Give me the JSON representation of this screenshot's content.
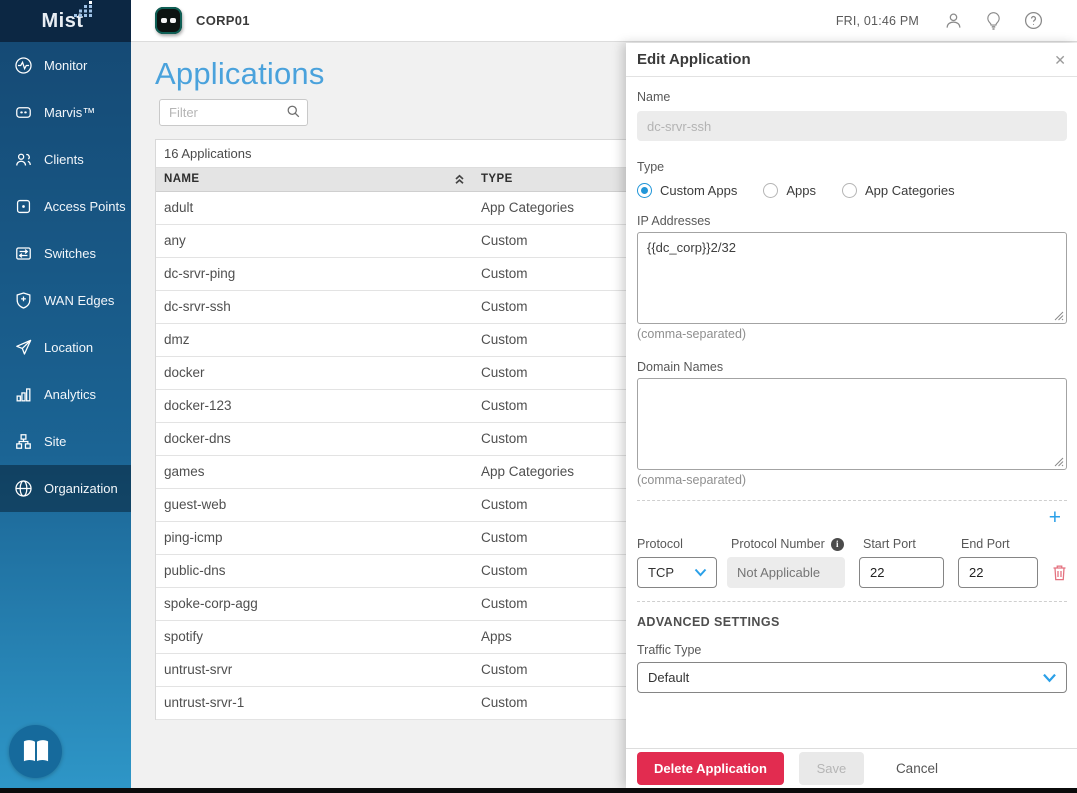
{
  "brand": {
    "logo_text": "Mist"
  },
  "topbar": {
    "org_name": "CORP01",
    "time": "FRI, 01:46 PM",
    "icons": [
      "marvis-icon",
      "account-icon",
      "bulb-icon",
      "help-icon"
    ]
  },
  "sidebar": {
    "active": "Organization",
    "items": [
      {
        "label": "Monitor",
        "icon": "monitor-icon"
      },
      {
        "label": "Marvis™",
        "icon": "marvis-icon"
      },
      {
        "label": "Clients",
        "icon": "clients-icon"
      },
      {
        "label": "Access Points",
        "icon": "access-points-icon"
      },
      {
        "label": "Switches",
        "icon": "switches-icon"
      },
      {
        "label": "WAN Edges",
        "icon": "wan-edges-icon"
      },
      {
        "label": "Location",
        "icon": "location-icon"
      },
      {
        "label": "Analytics",
        "icon": "analytics-icon"
      },
      {
        "label": "Site",
        "icon": "site-icon"
      },
      {
        "label": "Organization",
        "icon": "organization-icon"
      }
    ],
    "help_icon": "open-book-icon"
  },
  "main": {
    "title": "Applications",
    "filter_placeholder": "Filter",
    "count_label": "16 Applications",
    "table": {
      "columns": [
        "NAME",
        "TYPE"
      ],
      "sort_column": "NAME",
      "sort_direction": "asc",
      "rows": [
        [
          "adult",
          "App Categories"
        ],
        [
          "any",
          "Custom"
        ],
        [
          "dc-srvr-ping",
          "Custom"
        ],
        [
          "dc-srvr-ssh",
          "Custom"
        ],
        [
          "dmz",
          "Custom"
        ],
        [
          "docker",
          "Custom"
        ],
        [
          "docker-123",
          "Custom"
        ],
        [
          "docker-dns",
          "Custom"
        ],
        [
          "games",
          "App Categories"
        ],
        [
          "guest-web",
          "Custom"
        ],
        [
          "ping-icmp",
          "Custom"
        ],
        [
          "public-dns",
          "Custom"
        ],
        [
          "spoke-corp-agg",
          "Custom"
        ],
        [
          "spotify",
          "Apps"
        ],
        [
          "untrust-srvr",
          "Custom"
        ],
        [
          "untrust-srvr-1",
          "Custom"
        ]
      ]
    }
  },
  "panel": {
    "title": "Edit Application",
    "close_glyph": "✕",
    "name_label": "Name",
    "name_value": "dc-srvr-ssh",
    "type_label": "Type",
    "type_options": [
      "Custom Apps",
      "Apps",
      "App Categories"
    ],
    "type_selected": "Custom Apps",
    "ip_label": "IP Addresses",
    "ip_value": "{{dc_corp}}2/32",
    "ip_hint": "(comma-separated)",
    "domain_label": "Domain Names",
    "domain_value": "",
    "domain_hint": "(comma-separated)",
    "add_glyph": "+",
    "protocol_label": "Protocol",
    "protocol_value": "TCP",
    "protocol_number_label": "Protocol Number",
    "protocol_number_placeholder": "Not Applicable",
    "start_port_label": "Start Port",
    "start_port_value": "22",
    "end_port_label": "End Port",
    "end_port_value": "22",
    "advanced_label": "ADVANCED SETTINGS",
    "traffic_label": "Traffic Type",
    "traffic_value": "Default",
    "delete_label": "Delete Application",
    "save_label": "Save",
    "cancel_label": "Cancel"
  },
  "colors": {
    "accent_blue": "#2ba0e8",
    "title_blue": "#4aa2dc",
    "sidebar_top": "#154a75",
    "sidebar_bottom": "#2e96c7",
    "logo_bg": "#0c2743",
    "delete_red": "#e22c50",
    "trash_red": "#e4717f",
    "radio_selected": "#2196d8"
  }
}
